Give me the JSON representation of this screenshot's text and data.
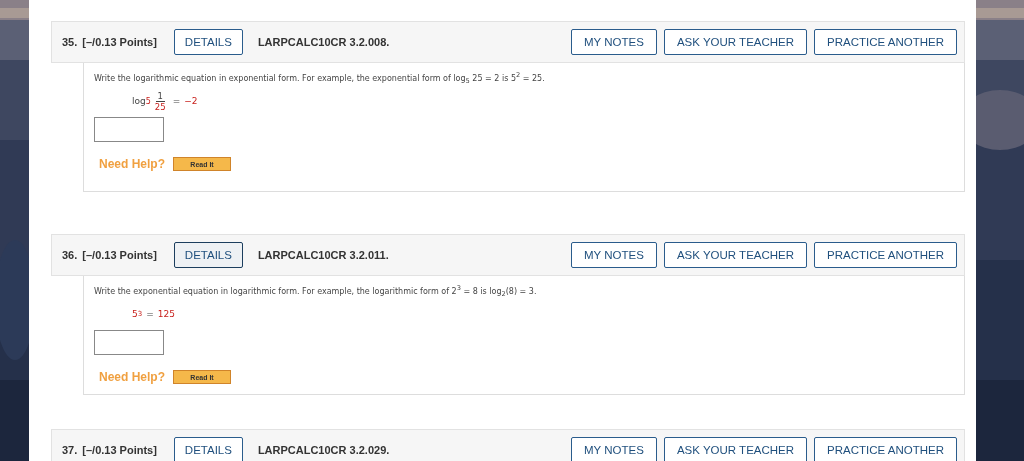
{
  "questions": [
    {
      "number": "35.",
      "points": "[–/0.13 Points]",
      "details": {
        "label": "DETAILS",
        "focused": false
      },
      "code": "LARPCALC10CR 3.2.008.",
      "actions": [
        "MY NOTES",
        "ASK YOUR TEACHER",
        "PRACTICE ANOTHER"
      ],
      "prompt": "Write the logarithmic equation in exponential form. For example, the exponential form of  log$_{5}$ 25 = 2  is  5$^{2}$ = 25.",
      "equation": {
        "kind": "log_fraction",
        "log": "log",
        "base": "5",
        "numerator": "1",
        "denominator": "25",
        "equals": "=",
        "result": "−2"
      },
      "help_label": "Need Help?",
      "help_button": "Read It"
    },
    {
      "number": "36.",
      "points": "[–/0.13 Points]",
      "details": {
        "label": "DETAILS",
        "focused": true
      },
      "code": "LARPCALC10CR 3.2.011.",
      "actions": [
        "MY NOTES",
        "ASK YOUR TEACHER",
        "PRACTICE ANOTHER"
      ],
      "prompt": "Write the exponential equation in logarithmic form. For example, the logarithmic form of  2$^{3}$ = 8 is log$_{2}$(8) = 3.",
      "equation": {
        "kind": "power",
        "base": "5",
        "exponent": "3",
        "equals": "=",
        "result": "125"
      },
      "help_label": "Need Help?",
      "help_button": "Read It"
    },
    {
      "number": "37.",
      "points": "[–/0.13 Points]",
      "details": {
        "label": "DETAILS",
        "focused": false
      },
      "code": "LARPCALC10CR 3.2.029.",
      "actions": [
        "MY NOTES",
        "ASK YOUR TEACHER",
        "PRACTICE ANOTHER"
      ]
    }
  ]
}
